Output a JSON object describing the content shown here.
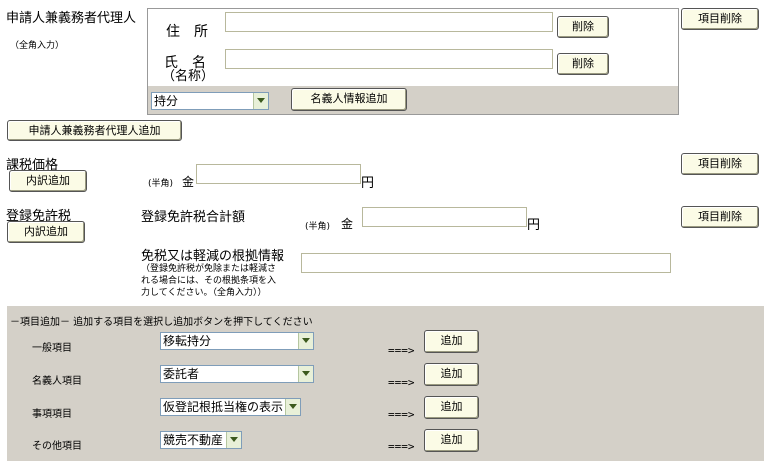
{
  "agent_section": {
    "title": "申請人兼義務者代理人",
    "fullwidth_note": "（全角入力）",
    "address_label": "住　所",
    "address_value": "",
    "address_delete": "削除",
    "name_label": "氏　名",
    "name_sub": "（名称）",
    "name_value": "",
    "name_delete": "削除",
    "share_select": "持分",
    "add_holder_info": "名義人情報追加",
    "item_delete": "項目削除",
    "add_agent": "申請人兼義務者代理人追加"
  },
  "taxable_value": {
    "title": "課税価格",
    "breakdown_add": "内訳追加",
    "halfwidth_note": "(半角)",
    "money_prefix": "金",
    "value": "",
    "unit": "円",
    "item_delete": "項目削除"
  },
  "registration_tax": {
    "title": "登録免許税",
    "breakdown_add": "内訳追加",
    "total_label": "登録免許税合計額",
    "halfwidth_note": "(半角)",
    "money_prefix": "金",
    "value": "",
    "unit": "円",
    "item_delete": "項目削除"
  },
  "exemption": {
    "label": "免税又は軽減の根拠情報",
    "note_line1": "（登録免許税が免除または軽減さ",
    "note_line2": "れる場合には、その根拠条項を入",
    "note_line3": "力してください。（全角入力））",
    "value": ""
  },
  "add_panel": {
    "header": "－項目追加－ 追加する項目を選択し追加ボタンを押下してください",
    "arrow": "===>",
    "rows": [
      {
        "label": "一般項目",
        "selected": "移転持分",
        "button": "追加"
      },
      {
        "label": "名義人項目",
        "selected": "委託者",
        "button": "追加"
      },
      {
        "label": "事項項目",
        "selected": "仮登記根抵当権の表示",
        "button": "追加"
      },
      {
        "label": "その他項目",
        "selected": "競売不動産",
        "button": "追加"
      }
    ]
  },
  "colors": {
    "panel_bg": "#d4d0c8",
    "button_bg": "#fbfbe6",
    "select_arrow": "#e8f0d8"
  }
}
